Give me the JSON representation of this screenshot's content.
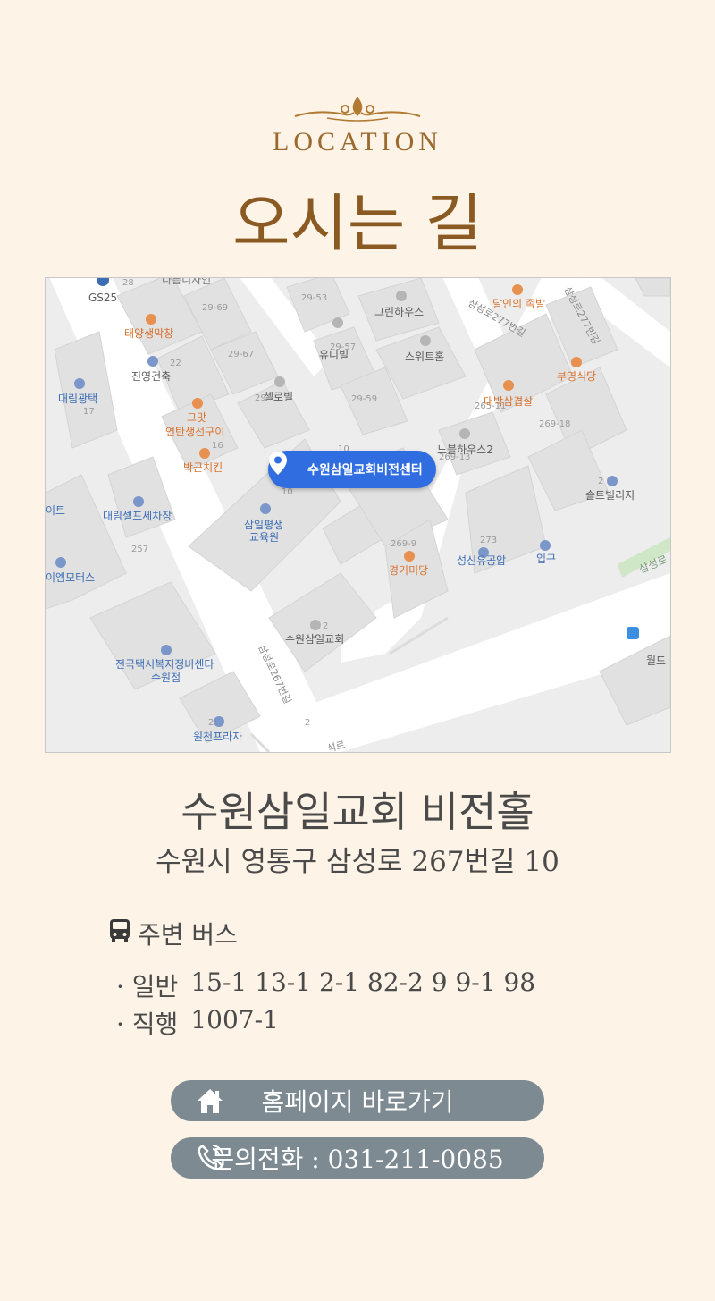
{
  "header": {
    "eyebrow": "LOCATION",
    "title": "오시는 길"
  },
  "map": {
    "marker_label": "수원삼일교회비전센터",
    "place_labels": [
      {
        "text": "GS25",
        "color": "#5b5b5b"
      },
      {
        "text": "다름디자인",
        "color": "#7a7a7a"
      },
      {
        "text": "태양생막창",
        "color": "#d9722d"
      },
      {
        "text": "진영건축",
        "color": "#5b5b5b"
      },
      {
        "text": "대림광택",
        "color": "#3c6db4"
      },
      {
        "text": "그맛",
        "color": "#d9722d"
      },
      {
        "text": "연탄생선구이",
        "color": "#d9722d"
      },
      {
        "text": "박군치킨",
        "color": "#d9722d"
      },
      {
        "text": "첼로빌",
        "color": "#5b5b5b"
      },
      {
        "text": "유니빌",
        "color": "#5b5b5b"
      },
      {
        "text": "그린하우스",
        "color": "#5b5b5b"
      },
      {
        "text": "스위트홈",
        "color": "#5b5b5b"
      },
      {
        "text": "달인의 족발",
        "color": "#d9722d"
      },
      {
        "text": "부영식당",
        "color": "#d9722d"
      },
      {
        "text": "대박삼겹살",
        "color": "#d9722d"
      },
      {
        "text": "노블하우스2",
        "color": "#5b5b5b"
      },
      {
        "text": "솔트빌리지",
        "color": "#5b5b5b"
      },
      {
        "text": "대림셀프세차장",
        "color": "#3c6db4"
      },
      {
        "text": "이트",
        "color": "#3c6db4"
      },
      {
        "text": "삼일평생",
        "color": "#3c6db4"
      },
      {
        "text": "교육원",
        "color": "#3c6db4"
      },
      {
        "text": "경기미당",
        "color": "#d9722d"
      },
      {
        "text": "성신유공압",
        "color": "#3c6db4"
      },
      {
        "text": "입구",
        "color": "#3c6db4"
      },
      {
        "text": "이엠모터스",
        "color": "#3c6db4"
      },
      {
        "text": "수원삼일교회",
        "color": "#5b5b5b"
      },
      {
        "text": "전국택시복지정비센타",
        "color": "#3c6db4"
      },
      {
        "text": "수원점",
        "color": "#3c6db4"
      },
      {
        "text": "원천프라자",
        "color": "#3c6db4"
      },
      {
        "text": "월드",
        "color": "#5b5b5b"
      },
      {
        "text": "삼성로",
        "color": "#7a9a7a"
      }
    ],
    "road_labels": [
      "삼성로277번길",
      "삼성로277번길",
      "삼성로267번길",
      "석로"
    ],
    "lot_numbers": [
      "28",
      "29-69",
      "29-53",
      "22",
      "29-67",
      "29-57",
      "29",
      "29-59",
      "17",
      "16",
      "10",
      "10",
      "265-11",
      "269-13",
      "269-18",
      "257",
      "269-9",
      "273",
      "2",
      "2",
      "2",
      "2",
      "25"
    ]
  },
  "venue": {
    "name": "수원삼일교회 비전홀",
    "address": "수원시 영통구 삼성로 267번길 10"
  },
  "bus": {
    "heading": "주변 버스",
    "lines": [
      {
        "type": "· 일반",
        "routes": "15-1 13-1 2-1 82-2 9 9-1 98"
      },
      {
        "type": "· 직행",
        "routes": "1007-1"
      }
    ]
  },
  "buttons": {
    "homepage_label": "홈페이지 바로가기",
    "phone_label": "문의전화 : 031-211-0085"
  },
  "colors": {
    "background": "#fdf3e6",
    "title": "#8a5a22",
    "button": "#7d8a92",
    "marker": "#2f6de0"
  }
}
